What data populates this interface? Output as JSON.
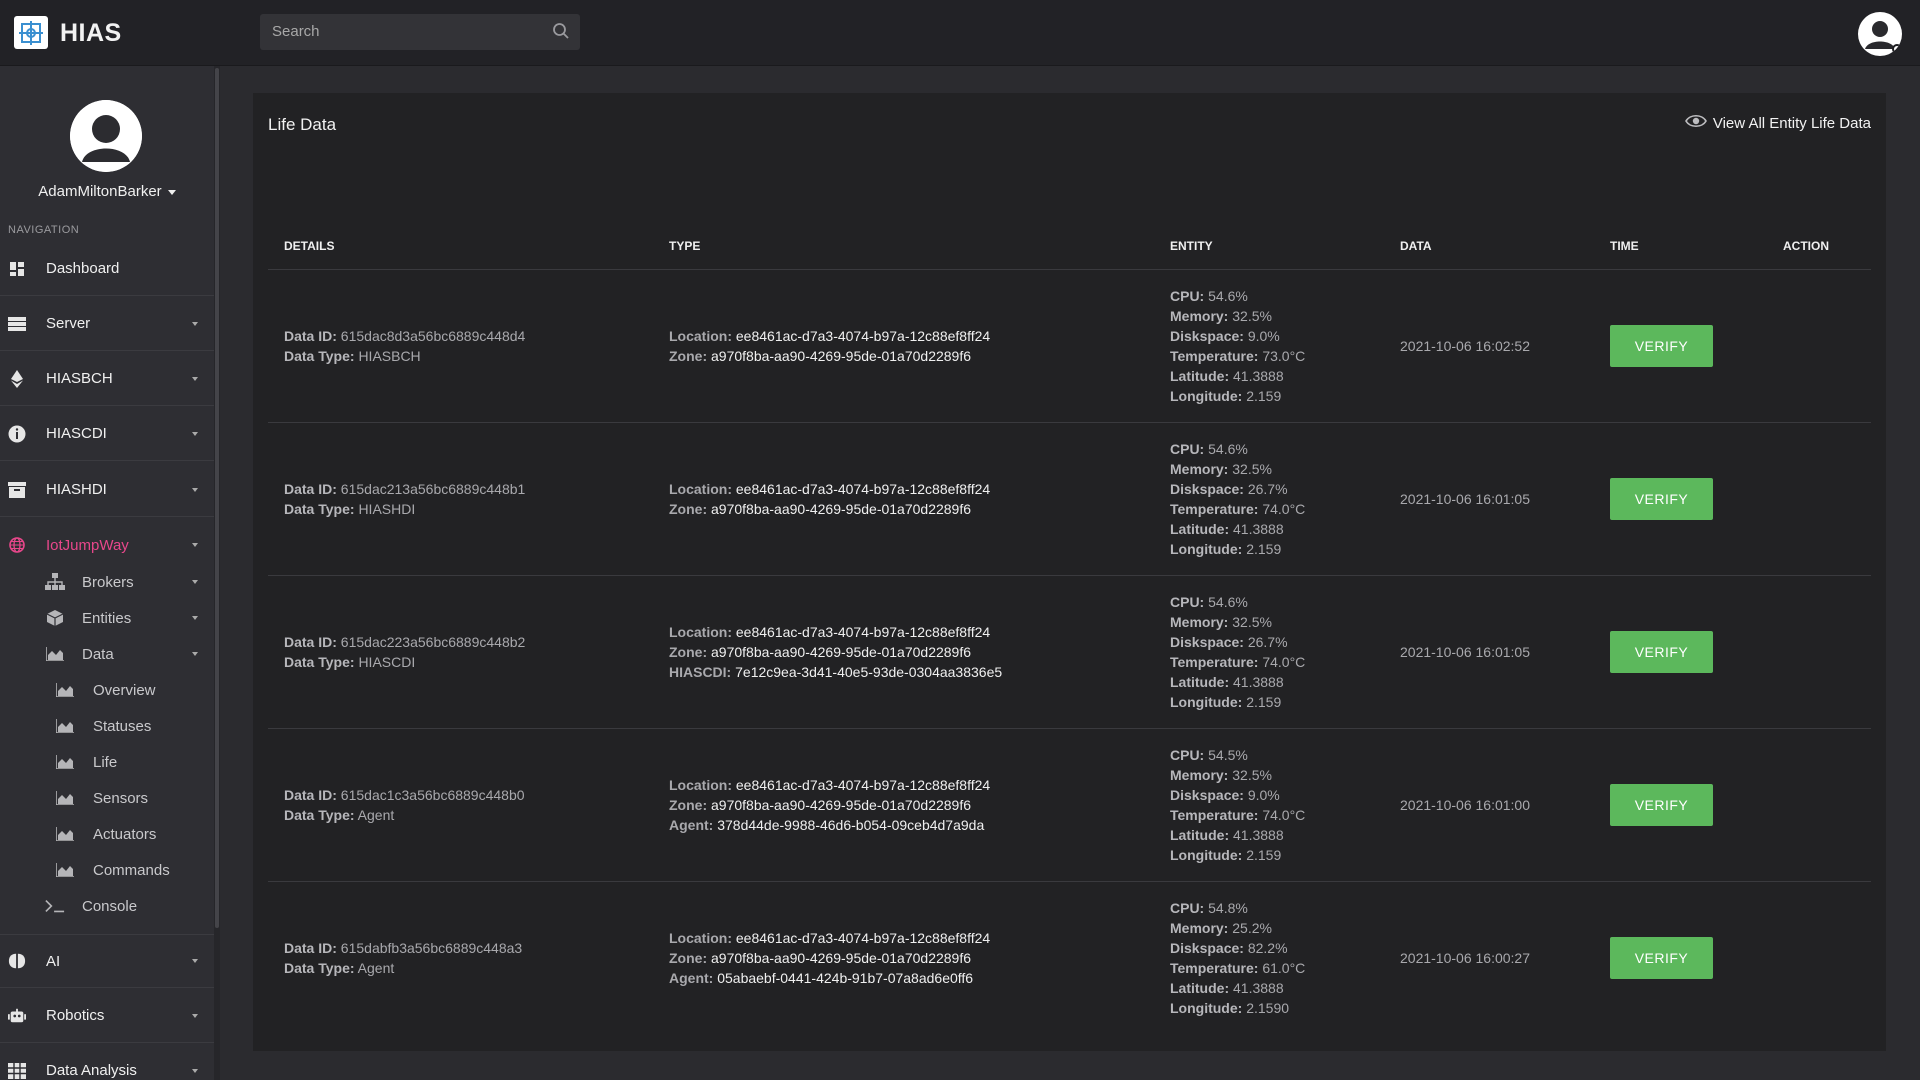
{
  "app": {
    "title": "HIAS"
  },
  "search": {
    "placeholder": "Search"
  },
  "user": {
    "name": "AdamMiltonBarker"
  },
  "sidebar": {
    "heading": "NAVIGATION",
    "items": [
      {
        "label": "Dashboard",
        "icon": "dashboard-icon"
      },
      {
        "label": "Server",
        "icon": "server-icon"
      },
      {
        "label": "HIASBCH",
        "icon": "ethereum-icon"
      },
      {
        "label": "HIASCDI",
        "icon": "info-circle-icon"
      },
      {
        "label": "HIASHDI",
        "icon": "archive-icon"
      },
      {
        "label": "IotJumpWay",
        "icon": "iot-globe-icon"
      }
    ],
    "iot_sub": [
      {
        "label": "Brokers",
        "icon": "network-icon"
      },
      {
        "label": "Entities",
        "icon": "cube-icon"
      },
      {
        "label": "Data",
        "icon": "area-chart-icon"
      }
    ],
    "data_sub": [
      {
        "label": "Overview",
        "icon": "area-chart-icon"
      },
      {
        "label": "Statuses",
        "icon": "area-chart-icon"
      },
      {
        "label": "Life",
        "icon": "area-chart-icon"
      },
      {
        "label": "Sensors",
        "icon": "area-chart-icon"
      },
      {
        "label": "Actuators",
        "icon": "area-chart-icon"
      },
      {
        "label": "Commands",
        "icon": "area-chart-icon"
      }
    ],
    "console": {
      "label": "Console",
      "icon": "terminal-icon"
    },
    "lower": [
      {
        "label": "AI",
        "icon": "brain-icon"
      },
      {
        "label": "Robotics",
        "icon": "robot-icon"
      },
      {
        "label": "Data Analysis",
        "icon": "table-icon"
      }
    ]
  },
  "panel": {
    "title": "Life Data",
    "view_all": "View All Entity Life Data"
  },
  "table": {
    "headers": [
      "DETAILS",
      "TYPE",
      "ENTITY",
      "DATA",
      "TIME",
      "ACTION"
    ],
    "labels": {
      "data_id": "Data ID:",
      "data_type": "Data Type:",
      "location": "Location:",
      "zone": "Zone:",
      "hiascdi": "HIASCDI:",
      "agent": "Agent:",
      "cpu": "CPU:",
      "memory": "Memory:",
      "diskspace": "Diskspace:",
      "temperature": "Temperature:",
      "latitude": "Latitude:",
      "longitude": "Longitude:"
    },
    "verify_label": "VERIFY",
    "rows": [
      {
        "data_id": "615dac8d3a56bc6889c448d4",
        "data_type": "HIASBCH",
        "location": "ee8461ac-d7a3-4074-b97a-12c88ef8ff24",
        "zone": "a970f8ba-aa90-4269-95de-01a70d2289f6",
        "cpu": "54.6%",
        "memory": "32.5%",
        "diskspace": "9.0%",
        "temperature": "73.0°C",
        "latitude": "41.3888",
        "longitude": "2.159",
        "time": "2021-10-06 16:02:52"
      },
      {
        "data_id": "615dac213a56bc6889c448b1",
        "data_type": "HIASHDI",
        "location": "ee8461ac-d7a3-4074-b97a-12c88ef8ff24",
        "zone": "a970f8ba-aa90-4269-95de-01a70d2289f6",
        "cpu": "54.6%",
        "memory": "32.5%",
        "diskspace": "26.7%",
        "temperature": "74.0°C",
        "latitude": "41.3888",
        "longitude": "2.159",
        "time": "2021-10-06 16:01:05"
      },
      {
        "data_id": "615dac223a56bc6889c448b2",
        "data_type": "HIASCDI",
        "location": "ee8461ac-d7a3-4074-b97a-12c88ef8ff24",
        "zone": "a970f8ba-aa90-4269-95de-01a70d2289f6",
        "hiascdi": "7e12c9ea-3d41-40e5-93de-0304aa3836e5",
        "cpu": "54.6%",
        "memory": "32.5%",
        "diskspace": "26.7%",
        "temperature": "74.0°C",
        "latitude": "41.3888",
        "longitude": "2.159",
        "time": "2021-10-06 16:01:05"
      },
      {
        "data_id": "615dac1c3a56bc6889c448b0",
        "data_type": "Agent",
        "location": "ee8461ac-d7a3-4074-b97a-12c88ef8ff24",
        "zone": "a970f8ba-aa90-4269-95de-01a70d2289f6",
        "agent": "378d44de-9988-46d6-b054-09ceb4d7a9da",
        "cpu": "54.5%",
        "memory": "32.5%",
        "diskspace": "9.0%",
        "temperature": "74.0°C",
        "latitude": "41.3888",
        "longitude": "2.159",
        "time": "2021-10-06 16:01:00"
      },
      {
        "data_id": "615dabfb3a56bc6889c448a3",
        "data_type": "Agent",
        "location": "ee8461ac-d7a3-4074-b97a-12c88ef8ff24",
        "zone": "a970f8ba-aa90-4269-95de-01a70d2289f6",
        "agent": "05abaebf-0441-424b-91b7-07a8ad6e0ff6",
        "cpu": "54.8%",
        "memory": "25.2%",
        "diskspace": "82.2%",
        "temperature": "61.0°C",
        "latitude": "41.3888",
        "longitude": "2.1590",
        "time": "2021-10-06 16:00:27"
      }
    ]
  },
  "colors": {
    "accent": "#e8478b",
    "verify": "#5cb85c",
    "panel": "#222224",
    "sidebar": "#2e2e33"
  }
}
